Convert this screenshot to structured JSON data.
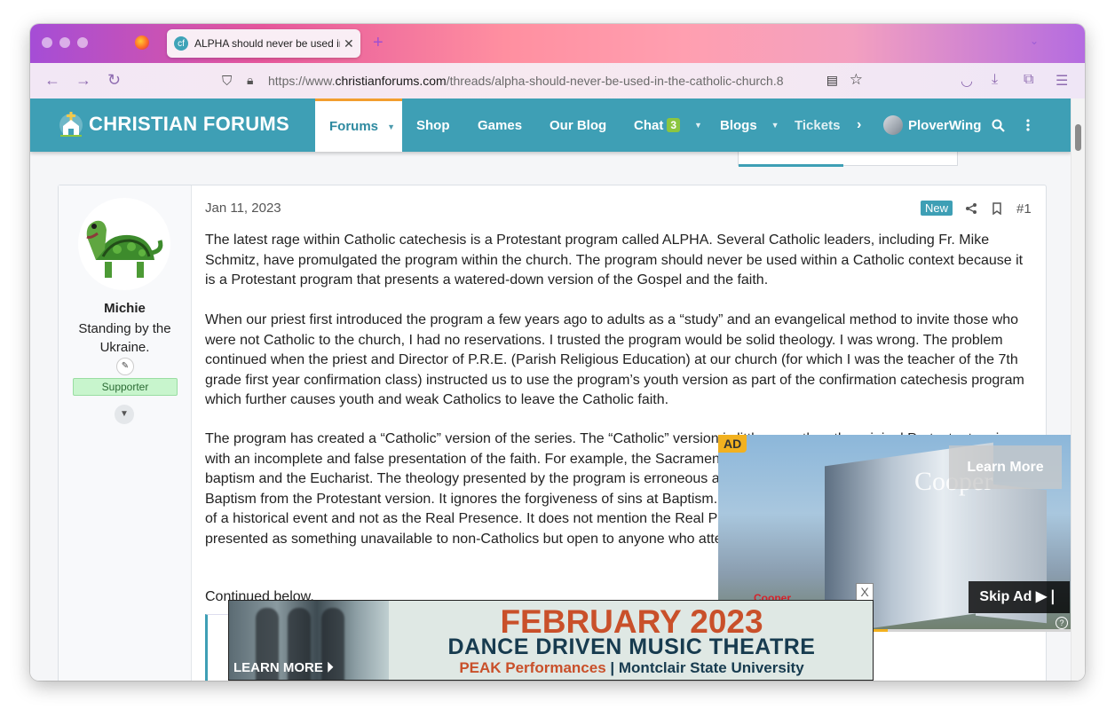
{
  "browser": {
    "tab_title": "ALPHA should never be used in",
    "tab_favicon": "cf",
    "url_scheme": "https://www.",
    "url_host": "christianforums.com",
    "url_path": "/threads/alpha-should-never-be-used-in-the-catholic-church.8",
    "accent": "#a04fd0"
  },
  "site": {
    "logo_text": "CHRISTIAN FORUMS",
    "brand_color": "#3e9fb5",
    "nav": {
      "forums": "Forums",
      "shop": "Shop",
      "games": "Games",
      "blog": "Our Blog",
      "chat": "Chat",
      "chat_count": "3",
      "blogs": "Blogs",
      "tickets": "Tickets",
      "user": "PloverWing"
    }
  },
  "post": {
    "author": "Michie",
    "user_title": "Standing by the Ukraine.",
    "user_badge": "Supporter",
    "date": "Jan 11, 2023",
    "new_label": "New",
    "post_number": "#1",
    "paragraphs": [
      "The latest rage within Catholic catechesis is a Protestant program called ALPHA. Several Catholic leaders, including Fr. Mike Schmitz, have promulgated the program within the church. The program should never be used within a Catholic context because it is a Protestant program that presents a watered-down version of the Gospel and the faith.",
      "When our priest first introduced the program a few years ago to adults as a “study” and an evangelical method to invite those who were not Catholic to the church, I had no reservations. I trusted the program would be solid theology. I was wrong. The problem continued when the priest and Director of P.R.E. (Parish Religious Education) at our church (for which I was the teacher of the 7th grade first year confirmation class) instructed us to use the program’s youth version as part of the confirmation catechesis program which further causes youth and weak Catholics to leave the Catholic faith.",
      "The program has created a “Catholic” version of the series. The “Catholic” version is little more than the original Protestant series with an incomplete and false presentation of the faith. For example, the Sacraments are only briefly mentioned; only mentioned baptism and the Eucharist. The theology presented by the program is erroneous and not what the Church teaches. It teaches Baptism from the Protestant version. It ignores the forgiveness of sins at Baptism. It presents the Holy Eucharist as a representation of a historical event and not as the Real Presence. It does not mention the Real Presence within Catholics. Holy Communion is presented as something unavailable to non-Catholics but open to anyone who attends the retreat held halfway through the course."
    ],
    "continued": "Continued below."
  },
  "video_ad": {
    "badge": "AD",
    "learn_more": "Learn More",
    "skip": "Skip Ad",
    "sign": "Cooper",
    "logo": "Cooper",
    "help": "?",
    "progress": 0.48
  },
  "banner_ad": {
    "close": "X",
    "learn_more": "LEARN MORE",
    "month": "FEBRUARY 2023",
    "subtitle": "DANCE DRIVEN MUSIC THEATRE",
    "venue_a": "PEAK Performances",
    "venue_sep": "|",
    "venue_b": "Montclair State University",
    "month_color": "#c9502a",
    "subtitle_color": "#173b4f"
  }
}
